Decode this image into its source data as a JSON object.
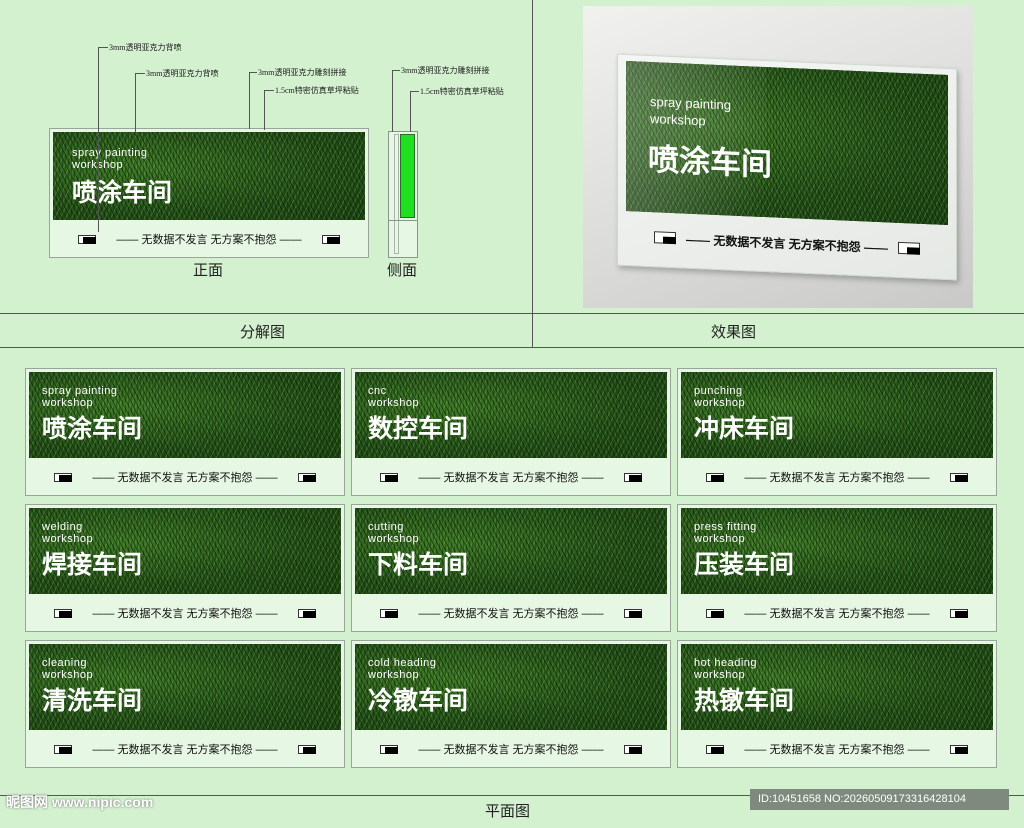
{
  "annotations": {
    "front_a": "3mm透明亚克力背喷",
    "front_b": "3mm透明亚克力背喷",
    "front_c": "3mm透明亚克力雕刻拼接",
    "front_d": "1.5cm特密仿真草坪粘贴",
    "side_a": "3mm透明亚克力雕刻拼接",
    "side_b": "1.5cm特密仿真草坪粘贴"
  },
  "labels": {
    "front": "正面",
    "side": "侧面",
    "exploded": "分解图",
    "effect": "效果图",
    "plan": "平面图"
  },
  "slogan": "—— 无数据不发言  无方案不抱怨 ——",
  "main_sign": {
    "en1": "spray painting",
    "en2": "workshop",
    "zh": "喷涂车间"
  },
  "signs": [
    {
      "en1": "spray painting",
      "en2": "workshop",
      "zh": "喷涂车间"
    },
    {
      "en1": "cnc",
      "en2": "workshop",
      "zh": "数控车间"
    },
    {
      "en1": "punching",
      "en2": "workshop",
      "zh": "冲床车间"
    },
    {
      "en1": "welding",
      "en2": "workshop",
      "zh": "焊接车间"
    },
    {
      "en1": "cutting",
      "en2": "workshop",
      "zh": "下料车间"
    },
    {
      "en1": "press fitting",
      "en2": "workshop",
      "zh": "压装车间"
    },
    {
      "en1": "cleaning",
      "en2": "workshop",
      "zh": "清洗车间"
    },
    {
      "en1": "cold heading",
      "en2": "workshop",
      "zh": "冷镦车间"
    },
    {
      "en1": "hot heading",
      "en2": "workshop",
      "zh": "热镦车间"
    }
  ],
  "watermark": {
    "left": "昵图网 www.nipic.com",
    "id": "ID:10451658 NO:20260509173316428104"
  },
  "colors": {
    "background": "#d3f0cf",
    "grass": "#2a5a1c",
    "side_green": "#1ee01e"
  }
}
